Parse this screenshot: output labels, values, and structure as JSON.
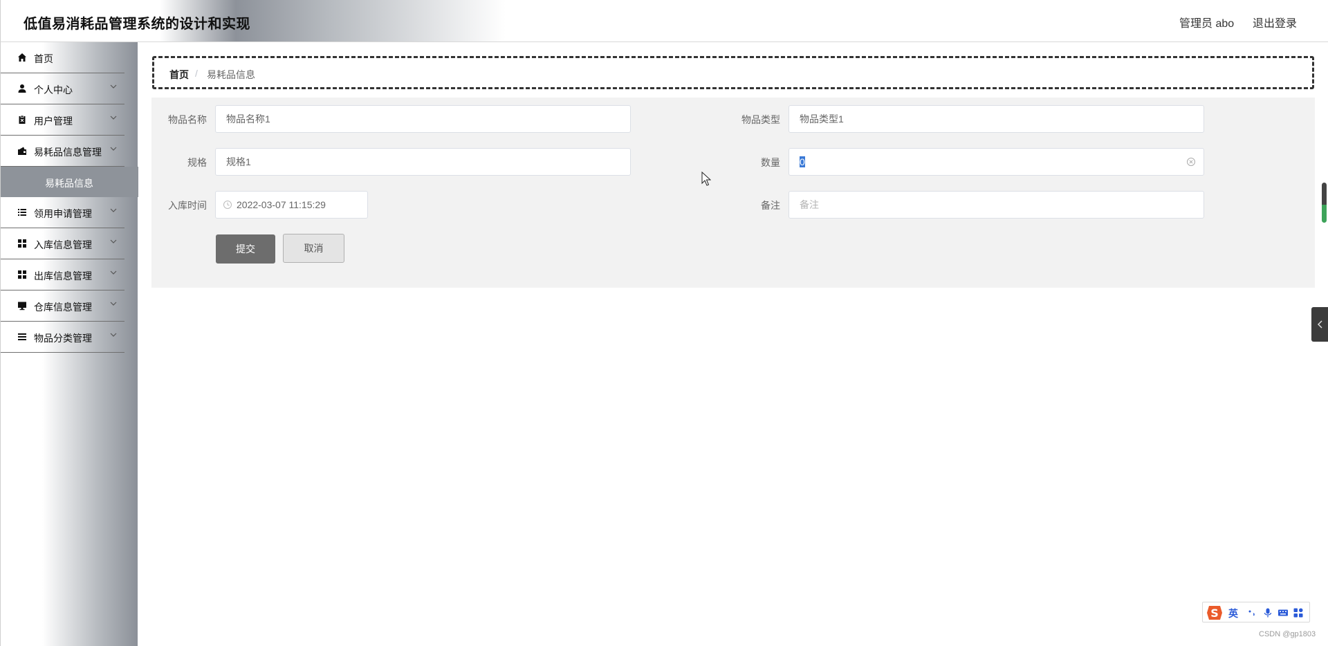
{
  "header": {
    "title": "低值易消耗品管理系统的设计和实现",
    "user": "管理员 abo",
    "logout": "退出登录"
  },
  "sidebar": {
    "items": [
      {
        "label": "首页",
        "icon": "home-icon"
      },
      {
        "label": "个人中心",
        "icon": "user-icon"
      },
      {
        "label": "用户管理",
        "icon": "clipboard-icon"
      },
      {
        "label": "易耗品信息管理",
        "icon": "wallet-icon"
      },
      {
        "label": "领用申请管理",
        "icon": "list-icon"
      },
      {
        "label": "入库信息管理",
        "icon": "grid-icon"
      },
      {
        "label": "出库信息管理",
        "icon": "grid-icon"
      },
      {
        "label": "仓库信息管理",
        "icon": "monitor-icon"
      },
      {
        "label": "物品分类管理",
        "icon": "menu-icon"
      }
    ],
    "sub_item": "易耗品信息"
  },
  "breadcrumb": {
    "home": "首页",
    "separator": "/",
    "current": "易耗品信息"
  },
  "form": {
    "name_label": "物品名称",
    "name_value": "物品名称1",
    "type_label": "物品类型",
    "type_value": "物品类型1",
    "spec_label": "规格",
    "spec_value": "规格1",
    "qty_label": "数量",
    "qty_value": "0",
    "time_label": "入库时间",
    "time_value": "2022-03-07 11:15:29",
    "remark_label": "备注",
    "remark_placeholder": "备注",
    "submit": "提交",
    "cancel": "取消"
  },
  "ime": {
    "lang": "英"
  },
  "watermark": "CSDN @gp1803",
  "colors": {
    "accent": "#6d6d6d",
    "sidebar_active": "#8e939a",
    "selection": "#3a79d6"
  }
}
